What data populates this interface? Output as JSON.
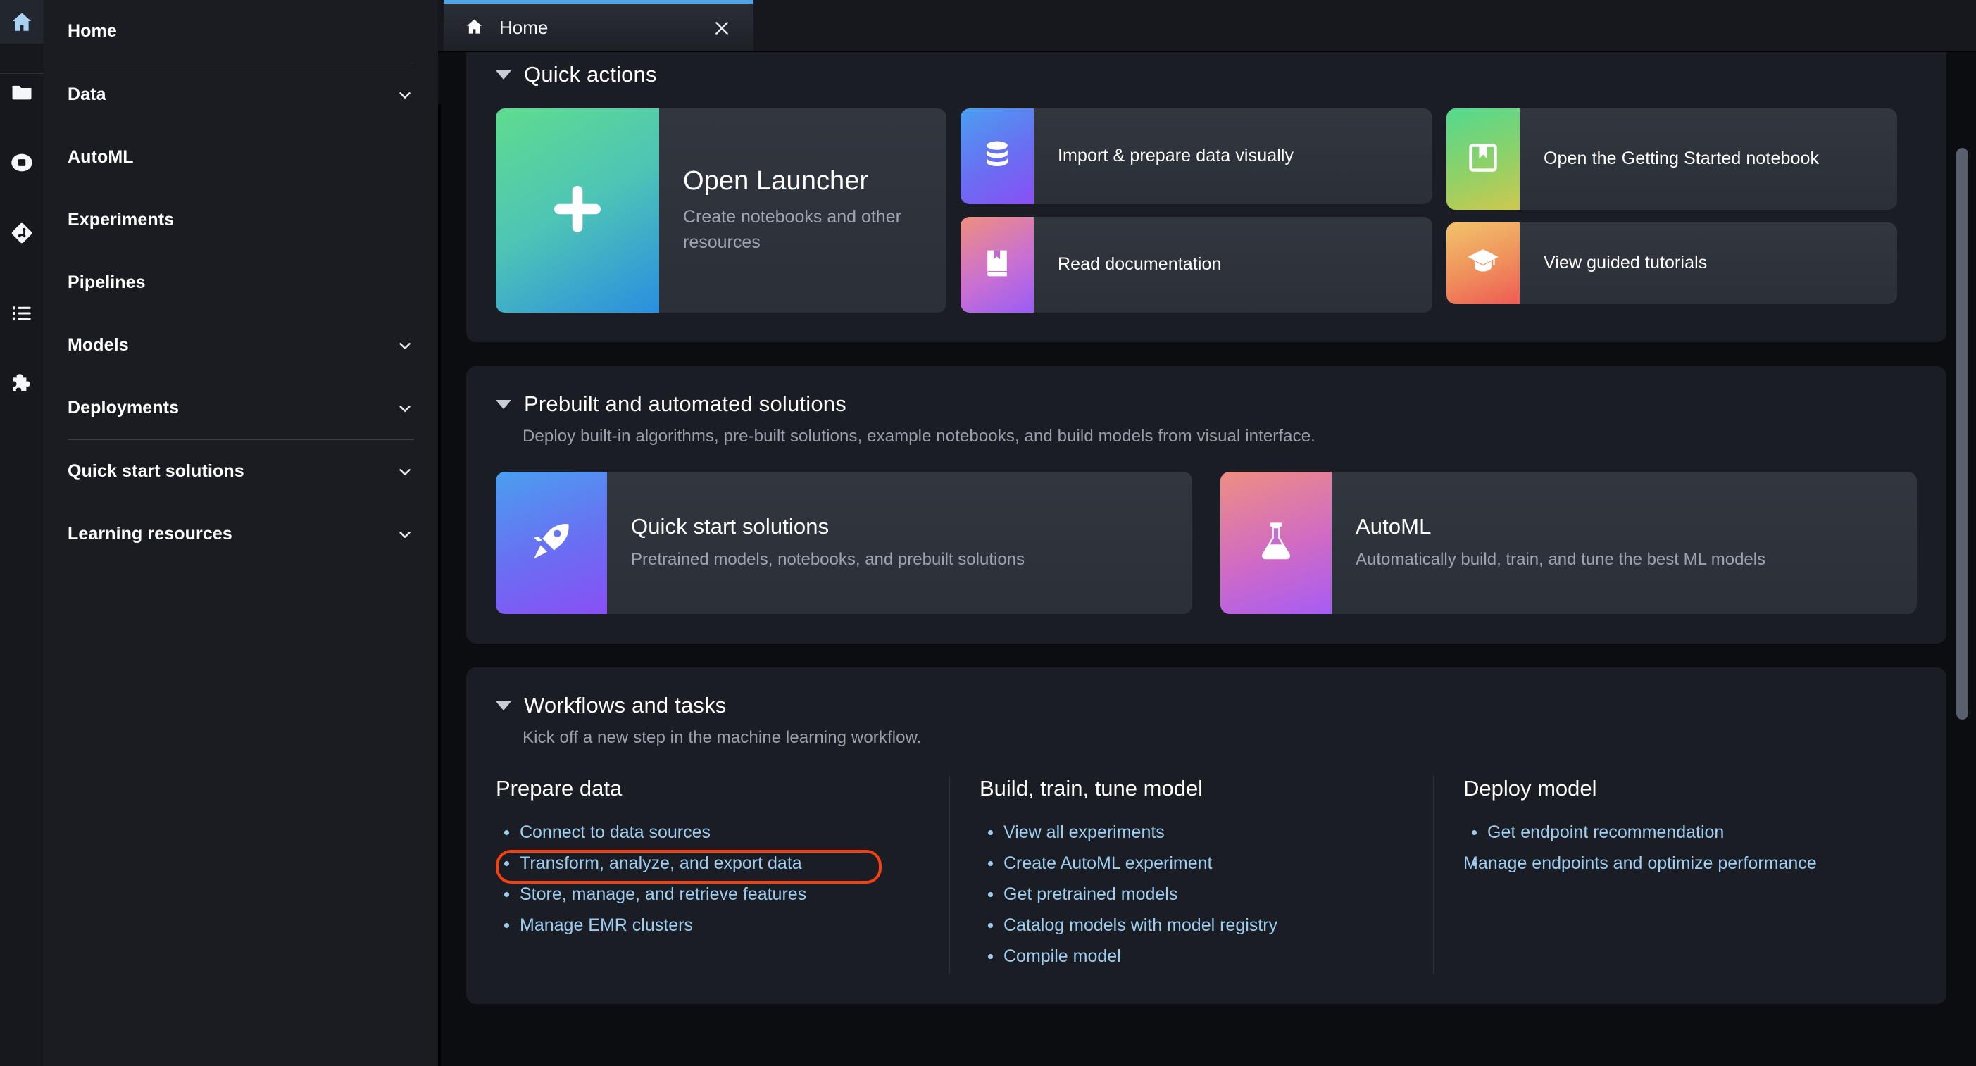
{
  "rail": {
    "items": [
      {
        "name": "home-icon",
        "label": "Home",
        "active": true
      },
      {
        "name": "folder-icon",
        "label": "File Browser",
        "active": false
      },
      {
        "name": "running-terminals-icon",
        "label": "Running Terminals and Kernels",
        "active": false
      },
      {
        "name": "git-icon",
        "label": "Git",
        "active": false
      },
      {
        "name": "table-of-contents-icon",
        "label": "Table of Contents",
        "active": false
      },
      {
        "name": "extensions-icon",
        "label": "Extension Manager",
        "active": false
      }
    ]
  },
  "sidebar": {
    "items": [
      {
        "label": "Home",
        "chevron": false
      },
      {
        "label": "Data",
        "chevron": true
      },
      {
        "label": "AutoML",
        "chevron": false
      },
      {
        "label": "Experiments",
        "chevron": false
      },
      {
        "label": "Pipelines",
        "chevron": false
      },
      {
        "label": "Models",
        "chevron": true
      },
      {
        "label": "Deployments",
        "chevron": true
      },
      {
        "label": "Quick start solutions",
        "chevron": true
      },
      {
        "label": "Learning resources",
        "chevron": true
      }
    ]
  },
  "tab": {
    "title": "Home",
    "icon": "home-icon",
    "close_label": "×"
  },
  "quick_actions": {
    "heading": "Quick actions",
    "launcher": {
      "title": "Open Launcher",
      "desc": "Create notebooks and other resources",
      "icon": "plus-icon"
    },
    "cards": [
      {
        "title": "Import & prepare data visually",
        "icon": "database-icon",
        "highlighted": true
      },
      {
        "title": "Read documentation",
        "icon": "book-icon",
        "highlighted": false
      },
      {
        "title": "Open the Getting Started notebook",
        "icon": "bookmark-icon",
        "highlighted": false
      },
      {
        "title": "View guided tutorials",
        "icon": "graduation-cap-icon",
        "highlighted": false
      }
    ]
  },
  "prebuilt": {
    "heading": "Prebuilt and automated solutions",
    "subheading": "Deploy built-in algorithms, pre-built solutions, example notebooks, and build models from visual interface.",
    "cards": [
      {
        "title": "Quick start solutions",
        "desc": "Pretrained models, notebooks, and prebuilt solutions",
        "icon": "rocket-icon"
      },
      {
        "title": "AutoML",
        "desc": "Automatically build, train, and tune the best ML models",
        "icon": "flask-icon"
      }
    ]
  },
  "workflows": {
    "heading": "Workflows and tasks",
    "subheading": "Kick off a new step in the machine learning workflow.",
    "columns": [
      {
        "title": "Prepare data",
        "links": [
          {
            "label": "Connect to data sources",
            "highlighted": false
          },
          {
            "label": "Transform, analyze, and export data",
            "highlighted": true
          },
          {
            "label": "Store, manage, and retrieve features",
            "highlighted": false
          },
          {
            "label": "Manage EMR clusters",
            "highlighted": false
          }
        ]
      },
      {
        "title": "Build, train, tune model",
        "links": [
          {
            "label": "View all experiments",
            "highlighted": false
          },
          {
            "label": "Create AutoML experiment",
            "highlighted": false
          },
          {
            "label": "Get pretrained models",
            "highlighted": false
          },
          {
            "label": "Catalog models with model registry",
            "highlighted": false
          },
          {
            "label": "Compile model",
            "highlighted": false
          }
        ]
      },
      {
        "title": "Deploy model",
        "links": [
          {
            "label": "Get endpoint recommendation",
            "highlighted": false
          },
          {
            "label": "Manage endpoints and optimize performance",
            "highlighted": false
          }
        ]
      }
    ]
  },
  "colors": {
    "highlight_ring": "#f6400f",
    "link": "#9ecdf0",
    "tab_accent": "#4da6e8",
    "page_bg": "#0c0d11",
    "panel_bg": "#1a1d24",
    "card_bg": "#2f333c"
  }
}
